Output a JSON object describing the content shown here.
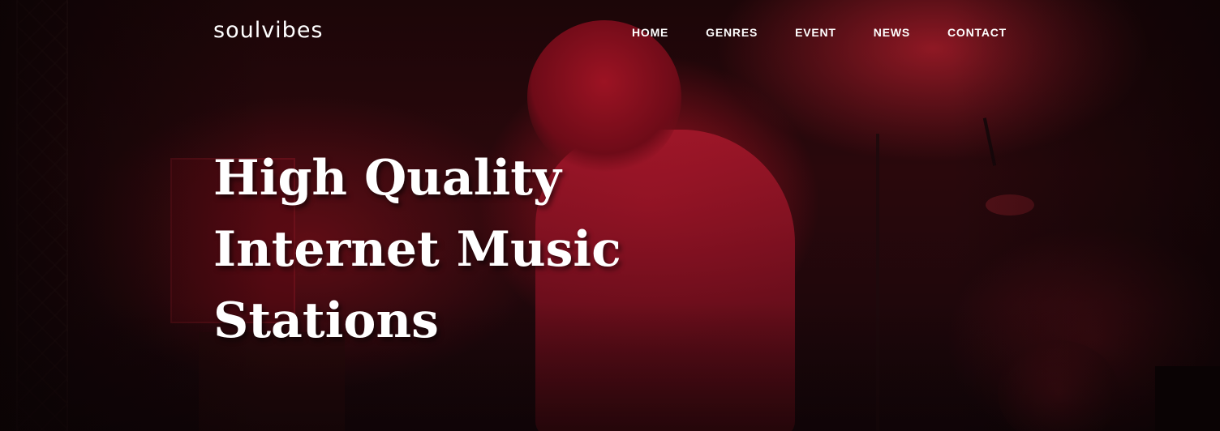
{
  "brand": {
    "logo": "soulvibes"
  },
  "nav": {
    "items": [
      {
        "label": "HOME"
      },
      {
        "label": "GENRES"
      },
      {
        "label": "EVENT"
      },
      {
        "label": "NEWS"
      },
      {
        "label": "CONTACT"
      }
    ]
  },
  "hero": {
    "headline_lines": [
      "High Quality",
      "Internet Music",
      "Stations"
    ],
    "background_tint": "#b01428",
    "background_dark": "#0b0506"
  }
}
